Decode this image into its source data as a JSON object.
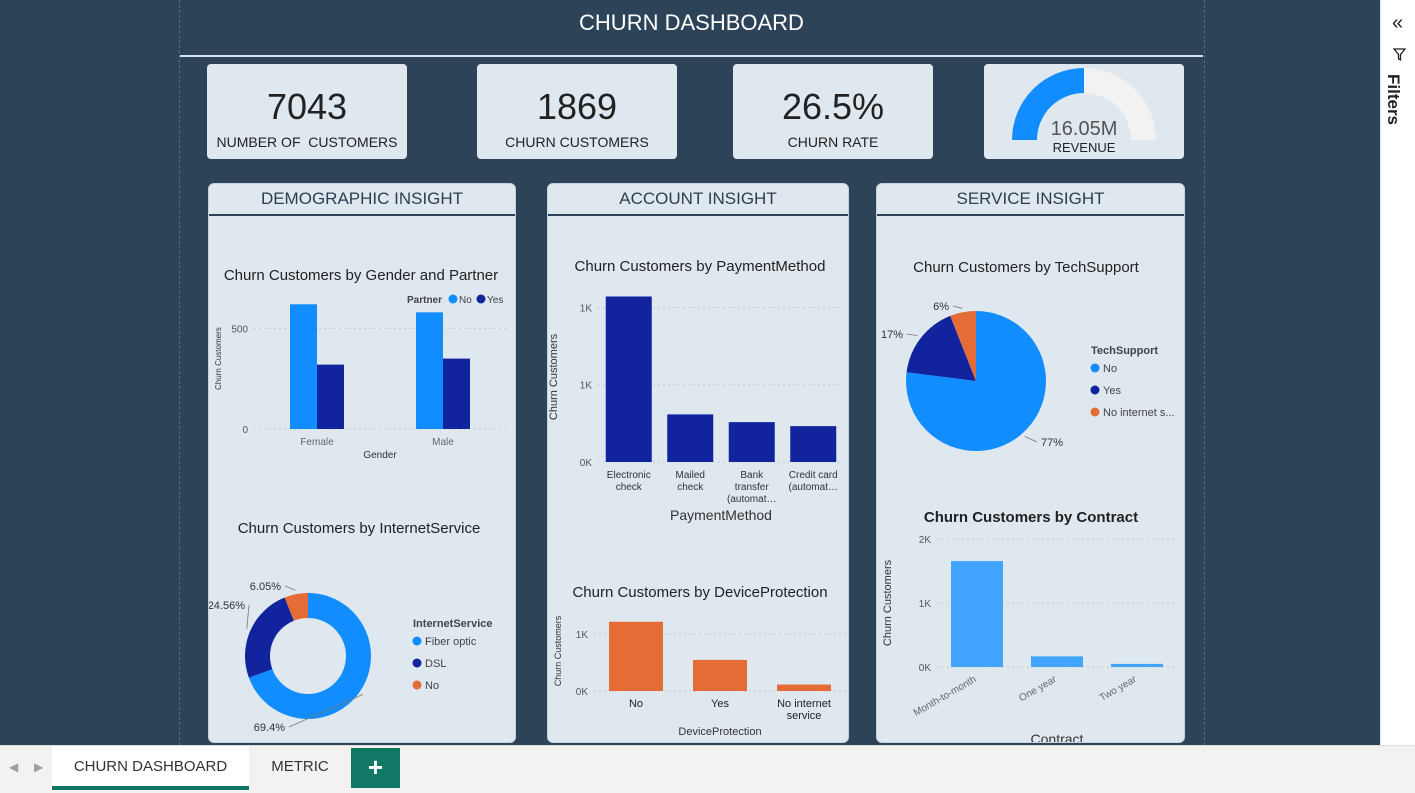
{
  "header": {
    "title": "CHURN DASHBOARD"
  },
  "kpis": {
    "customers": {
      "value": "7043",
      "label": "NUMBER OF  CUSTOMERS"
    },
    "churn": {
      "value": "1869",
      "label": "CHURN CUSTOMERS"
    },
    "rate": {
      "value": "26.5%",
      "label": "CHURN RATE"
    },
    "revenue": {
      "value": "16.05M",
      "label": "REVENUE",
      "gauge_fraction": 0.5
    }
  },
  "panels": {
    "demographic": "DEMOGRAPHIC INSIGHT",
    "account": "ACCOUNT INSIGHT",
    "service": "SERVICE INSIGHT"
  },
  "colors": {
    "light_blue": "#118dff",
    "dark_blue": "#12239e",
    "orange": "#e66c37",
    "contract_blue": "#41a4ff",
    "panel_bg": "#dfe7ef",
    "canvas_bg": "#2d4358",
    "tab_green": "#117865"
  },
  "chart_data": [
    {
      "id": "gender_partner",
      "type": "bar",
      "title": "Churn Customers by Gender and Partner",
      "xlabel": "Gender",
      "ylabel": "Churn Customers",
      "legend_title": "Partner",
      "categories": [
        "Female",
        "Male"
      ],
      "series": [
        {
          "name": "No",
          "values": [
            620,
            580
          ]
        },
        {
          "name": "Yes",
          "values": [
            320,
            350
          ]
        }
      ],
      "ylim": [
        0,
        700
      ],
      "yticks": [
        0,
        500
      ],
      "ytick_labels": [
        "0",
        "500"
      ]
    },
    {
      "id": "payment_method",
      "type": "bar",
      "title": "Churn Customers by PaymentMethod",
      "xlabel": "PaymentMethod",
      "ylabel": "Churn Customers",
      "categories": [
        "Electronic check",
        "Mailed check",
        "Bank transfer (automat…",
        "Credit card (automat…"
      ],
      "category_lines": [
        [
          "Electronic",
          "check"
        ],
        [
          "Mailed",
          "check"
        ],
        [
          "Bank",
          "transfer",
          "(automat…"
        ],
        [
          "Credit card",
          "(automat…"
        ]
      ],
      "values": [
        1071,
        308,
        258,
        232
      ],
      "ylim": [
        0,
        1100
      ],
      "yticks": [
        0,
        500,
        1000
      ],
      "ytick_labels": [
        "0K",
        "1K",
        "1K"
      ]
    },
    {
      "id": "device_protection",
      "type": "bar",
      "title": "Churn Customers by DeviceProtection",
      "xlabel": "DeviceProtection",
      "ylabel": "Churn Customers",
      "categories": [
        "No",
        "Yes",
        "No internet service"
      ],
      "category_lines": [
        [
          "No"
        ],
        [
          "Yes"
        ],
        [
          "No internet",
          "service"
        ]
      ],
      "values": [
        1211,
        545,
        113
      ],
      "ylim": [
        0,
        1400
      ],
      "yticks": [
        0,
        1000
      ],
      "ytick_labels": [
        "0K",
        "1K"
      ]
    },
    {
      "id": "internet_service",
      "type": "pie",
      "donut": true,
      "title": "Churn Customers by InternetService",
      "legend_title": "InternetService",
      "categories": [
        "Fiber optic",
        "DSL",
        "No"
      ],
      "values": [
        69.4,
        24.56,
        6.05
      ],
      "labels": [
        "69.4%",
        "24.56%",
        "6.05%"
      ]
    },
    {
      "id": "tech_support",
      "type": "pie",
      "title": "Churn Customers by TechSupport",
      "legend_title": "TechSupport",
      "categories": [
        "No",
        "Yes",
        "No internet s..."
      ],
      "values": [
        77,
        17,
        6
      ],
      "labels": [
        "77%",
        "17%",
        "6%"
      ]
    },
    {
      "id": "contract",
      "type": "bar",
      "title": "Churn Customers by Contract",
      "xlabel": "Contract",
      "ylabel": "Churn Customers",
      "categories": [
        "Month-to-month",
        "One year",
        "Two year"
      ],
      "values": [
        1655,
        166,
        48
      ],
      "ylim": [
        0,
        2000
      ],
      "yticks": [
        0,
        1000,
        2000
      ],
      "ytick_labels": [
        "0K",
        "1K",
        "2K"
      ]
    }
  ],
  "filters": {
    "label": "Filters"
  },
  "tabs": [
    {
      "label": "CHURN DASHBOARD"
    },
    {
      "label": "METRIC"
    }
  ],
  "add_tab_symbol": "+"
}
